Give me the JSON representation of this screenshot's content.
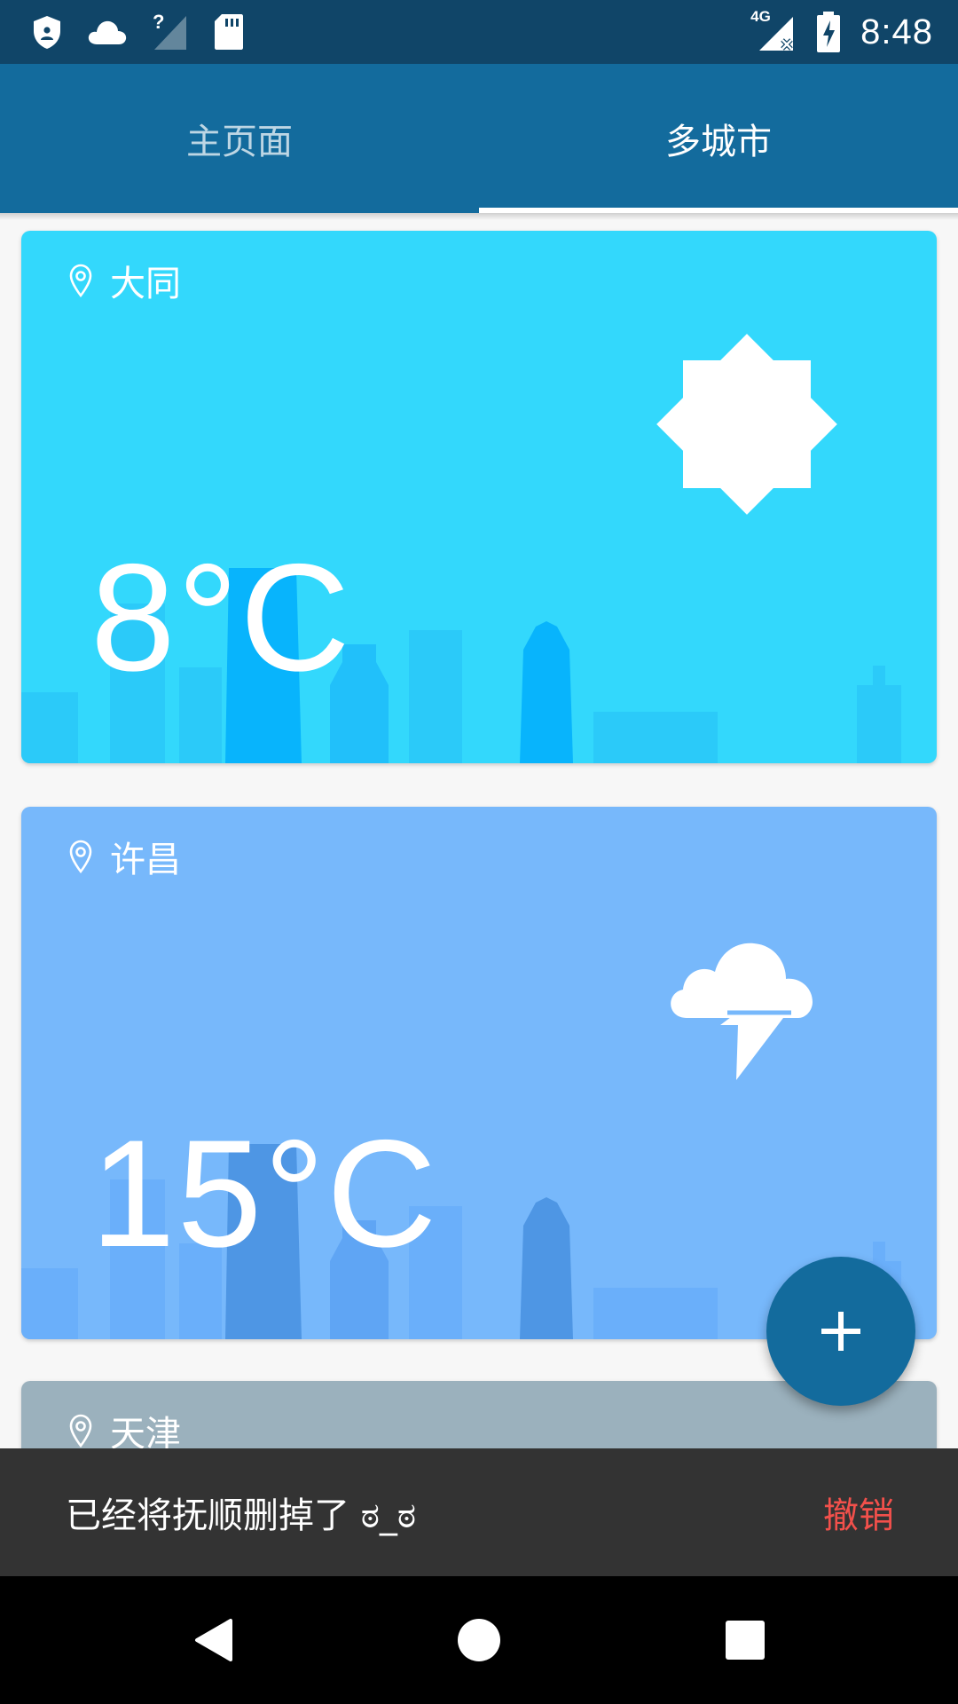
{
  "status_bar": {
    "time": "8:48",
    "network_label": "4G",
    "icons": [
      "shield-icon",
      "cloud-icon",
      "signal-unknown-icon",
      "sd-card-icon",
      "signal-4g-icon",
      "battery-charging-icon"
    ]
  },
  "tabs": [
    {
      "label": "主页面",
      "selected": false
    },
    {
      "label": "多城市",
      "selected": true
    }
  ],
  "cities": [
    {
      "name": "大同",
      "temperature": "8°C",
      "weather_icon": "sun-icon",
      "color": "#33d8fc"
    },
    {
      "name": "许昌",
      "temperature": "15°C",
      "weather_icon": "thunderstorm-icon",
      "color": "#77b8fb"
    },
    {
      "name": "天津",
      "color": "#9bb1bd"
    }
  ],
  "fab": {
    "icon": "plus-icon"
  },
  "snackbar": {
    "message": "已经将抚顺删掉了 ಠ_ಠ",
    "action": "撤销",
    "action_color": "#f2504b"
  },
  "colors": {
    "status_bar": "#104568",
    "app_bar": "#136b9d",
    "background": "#f7f7f7"
  },
  "nav_bar": {
    "icons": [
      "back-icon",
      "home-icon",
      "recents-icon"
    ]
  }
}
